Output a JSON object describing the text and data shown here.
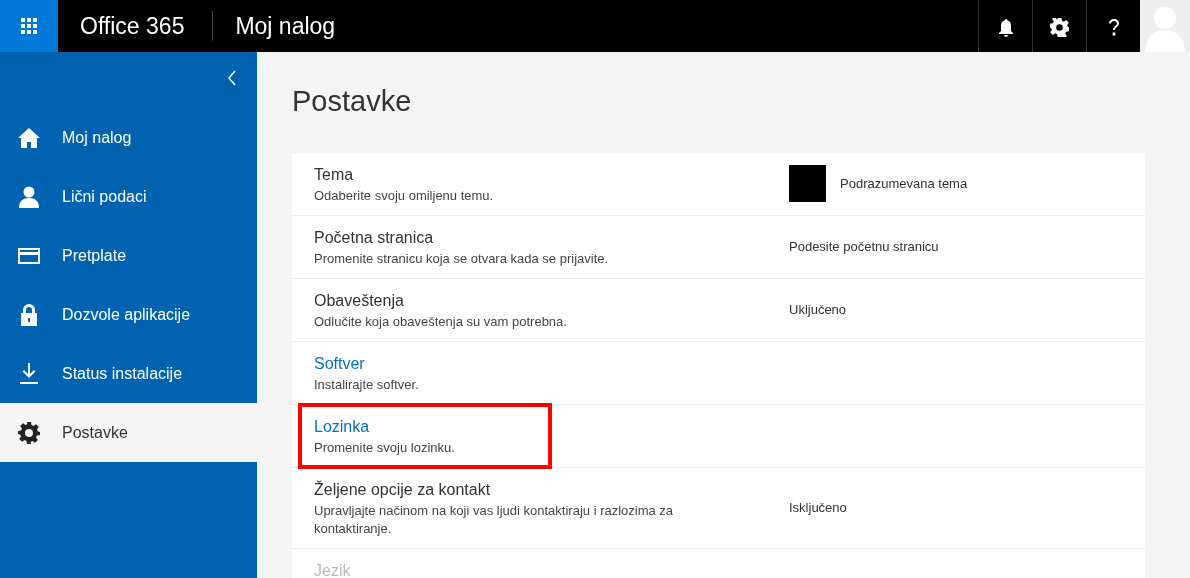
{
  "header": {
    "app_name": "Office 365",
    "page_title": "Moj nalog"
  },
  "sidebar": {
    "items": [
      {
        "label": "Moj nalog",
        "selected": false
      },
      {
        "label": "Lični podaci",
        "selected": false
      },
      {
        "label": "Pretplate",
        "selected": false
      },
      {
        "label": "Dozvole aplikacije",
        "selected": false
      },
      {
        "label": "Status instalacije",
        "selected": false
      },
      {
        "label": "Postavke",
        "selected": true
      }
    ]
  },
  "page": {
    "title": "Postavke"
  },
  "settings": [
    {
      "title": "Tema",
      "description": "Odaberite svoju omiljenu temu.",
      "value": "Podrazumevana tema",
      "color": "#000000",
      "link": false,
      "highlighted": false
    },
    {
      "title": "Početna stranica",
      "description": "Promenite stranicu koja se otvara kada se prijavite.",
      "value": "Podesite početnu stranicu",
      "link": false,
      "highlighted": false
    },
    {
      "title": "Obaveštenja",
      "description": "Odlučite koja obaveštenja su vam potrebna.",
      "value": "Uključeno",
      "link": false,
      "highlighted": false
    },
    {
      "title": "Softver",
      "description": "Instalirajte softver.",
      "link": true,
      "highlighted": false
    },
    {
      "title": "Lozinka",
      "description": "Promenite svoju lozinku.",
      "link": true,
      "highlighted": true
    },
    {
      "title": "Željene opcije za kontakt",
      "description": "Upravljajte načinom na koji vas ljudi kontaktiraju i razlozima za kontaktiranje.",
      "value": "Isključeno",
      "link": false,
      "highlighted": false
    },
    {
      "title": "Jezik",
      "link": false,
      "highlighted": false,
      "faded": true
    }
  ]
}
